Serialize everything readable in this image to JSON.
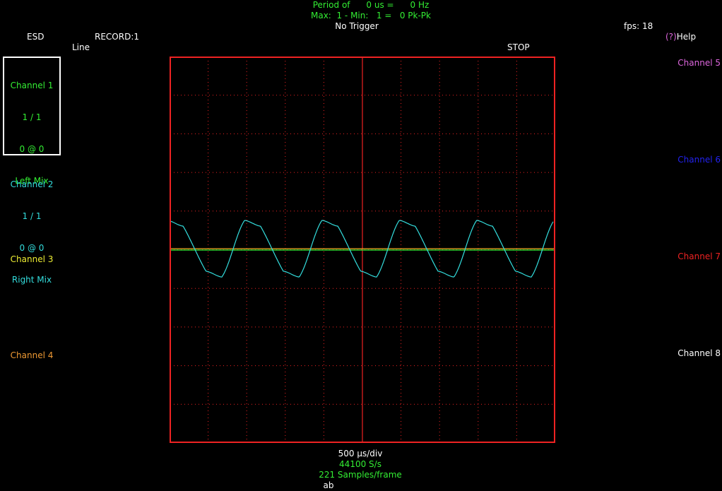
{
  "header": {
    "period_label": "Period of",
    "period_value": "0 us =",
    "freq_value": "0 Hz",
    "max_label": "Max:",
    "max_value": "1 - Min:",
    "min_value": "1 =",
    "pkpk_value": "0 Pk-Pk",
    "trigger": "No Trigger",
    "esd": "ESD",
    "record": "RECORD:1",
    "line": "Line",
    "stop": "STOP",
    "fps": "fps: 18",
    "help_prefix": "(?)",
    "help": "Help"
  },
  "channels_left": [
    {
      "name": "Channel 1",
      "scale": "1 / 1",
      "offset": "0 @ 0",
      "source": "Left Mix",
      "color": "#33ee33"
    },
    {
      "name": "Channel 2",
      "scale": "1 / 1",
      "offset": "0 @ 0",
      "source": "Right Mix",
      "color": "#33dddd"
    },
    {
      "name": "Channel 3",
      "color": "#eeee33"
    },
    {
      "name": "Channel 4",
      "color": "#ee9933"
    }
  ],
  "channels_right": [
    {
      "name": "Channel 5",
      "color": "#dd66dd"
    },
    {
      "name": "Channel 6",
      "color": "#2222ee"
    },
    {
      "name": "Channel 7",
      "color": "#ee2222"
    },
    {
      "name": "Channel 8",
      "color": "#ffffff"
    }
  ],
  "footer": {
    "time_div": "500 µs/div",
    "sample_rate": "44100 S/s",
    "samples_frame": "221 Samples/frame",
    "cut_text": "ab"
  },
  "scope_colors": {
    "border": "#ee2222",
    "grid": "#ee2222",
    "trace_ch1": "#33ee33",
    "trace_ch2": "#33dddd",
    "marker_line": "#eeaa22"
  }
}
